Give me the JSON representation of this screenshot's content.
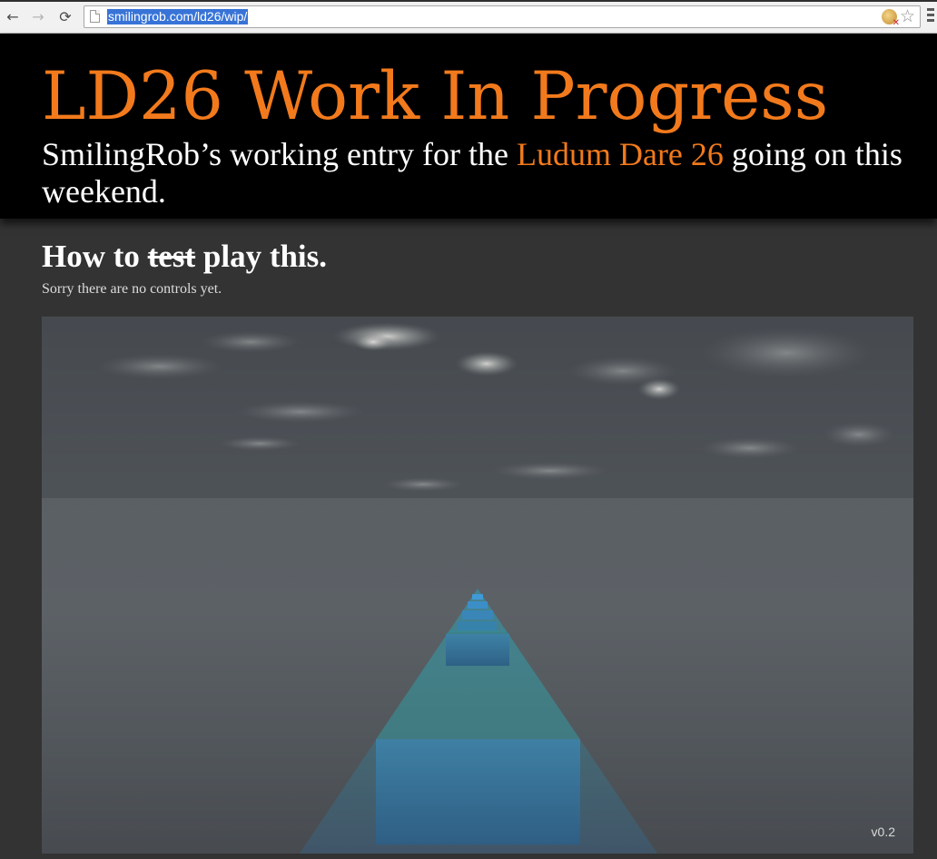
{
  "browser": {
    "url": "smilingrob.com/ld26/wip/",
    "back_icon": "←",
    "forward_icon": "→",
    "reload_icon": "⟳",
    "star_icon": "☆"
  },
  "header": {
    "title": "LD26 Work In Progress",
    "subtitle_before": "SmilingRob’s working entry for the ",
    "subtitle_link": "Ludum Dare 26",
    "subtitle_after": " going on this weekend.",
    "accent_color": "#f27a1c"
  },
  "section": {
    "heading_start": "How to ",
    "heading_struck": "test",
    "heading_end": " play this.",
    "note": "Sorry there are no controls yet."
  },
  "game": {
    "version": "v0.2"
  }
}
